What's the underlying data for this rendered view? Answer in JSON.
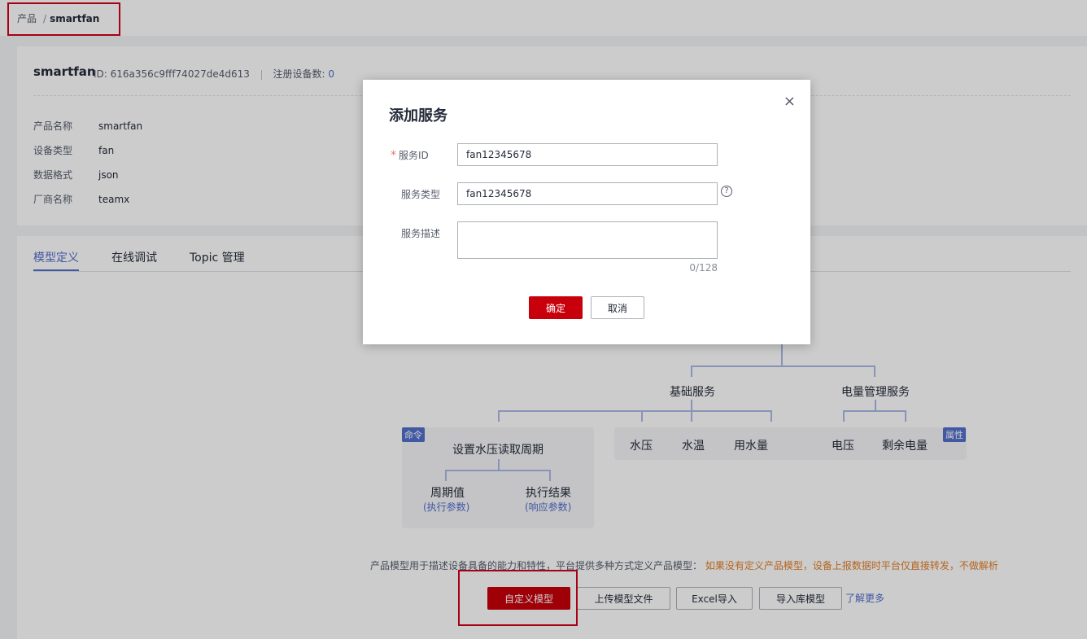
{
  "breadcrumb": {
    "root": "产品",
    "separator": "/",
    "current": "smartfan"
  },
  "product": {
    "name": "smartfan",
    "id_label": "ID:",
    "id_value": "616a356c9fff74027de4d613",
    "registered_label": "注册设备数:",
    "registered_count": "0",
    "fields": [
      {
        "key": "产品名称",
        "value": "smartfan"
      },
      {
        "key": "设备类型",
        "value": "fan"
      },
      {
        "key": "数据格式",
        "value": "json"
      },
      {
        "key": "厂商名称",
        "value": "teamx"
      }
    ]
  },
  "tabs": [
    "模型定义",
    "在线调试",
    "Topic 管理"
  ],
  "model": {
    "basic_service": "基础服务",
    "power_service": "电量管理服务",
    "command_tag": "命令",
    "property_tag": "属性",
    "command_name": "设置水压读取周期",
    "param1": "周期值",
    "param1_sub": "(执行参数)",
    "param2": "执行结果",
    "param2_sub": "(响应参数)",
    "props": [
      "水压",
      "水温",
      "用水量",
      "电压",
      "剩余电量"
    ]
  },
  "description": {
    "text": "产品模型用于描述设备具备的能力和特性，平台提供多种方式定义产品模型：",
    "warning": "如果没有定义产品模型，设备上报数据时平台仅直接转发，不做解析"
  },
  "actions": {
    "custom_model": "自定义模型",
    "upload_file": "上传模型文件",
    "excel_import": "Excel导入",
    "import_library": "导入库模型",
    "learn_more": "了解更多"
  },
  "dialog": {
    "title": "添加服务",
    "close": "×",
    "service_id_label": "服务ID",
    "service_id_value": "fan12345678",
    "service_type_label": "服务类型",
    "service_type_value": "fan12345678",
    "service_desc_label": "服务描述",
    "counter": "0/128",
    "help": "?",
    "ok": "确定",
    "cancel": "取消",
    "required_mark": "*"
  },
  "colors": {
    "primary": "#c7000b",
    "accent": "#526ecc",
    "highlight_box": "#d0021b"
  }
}
